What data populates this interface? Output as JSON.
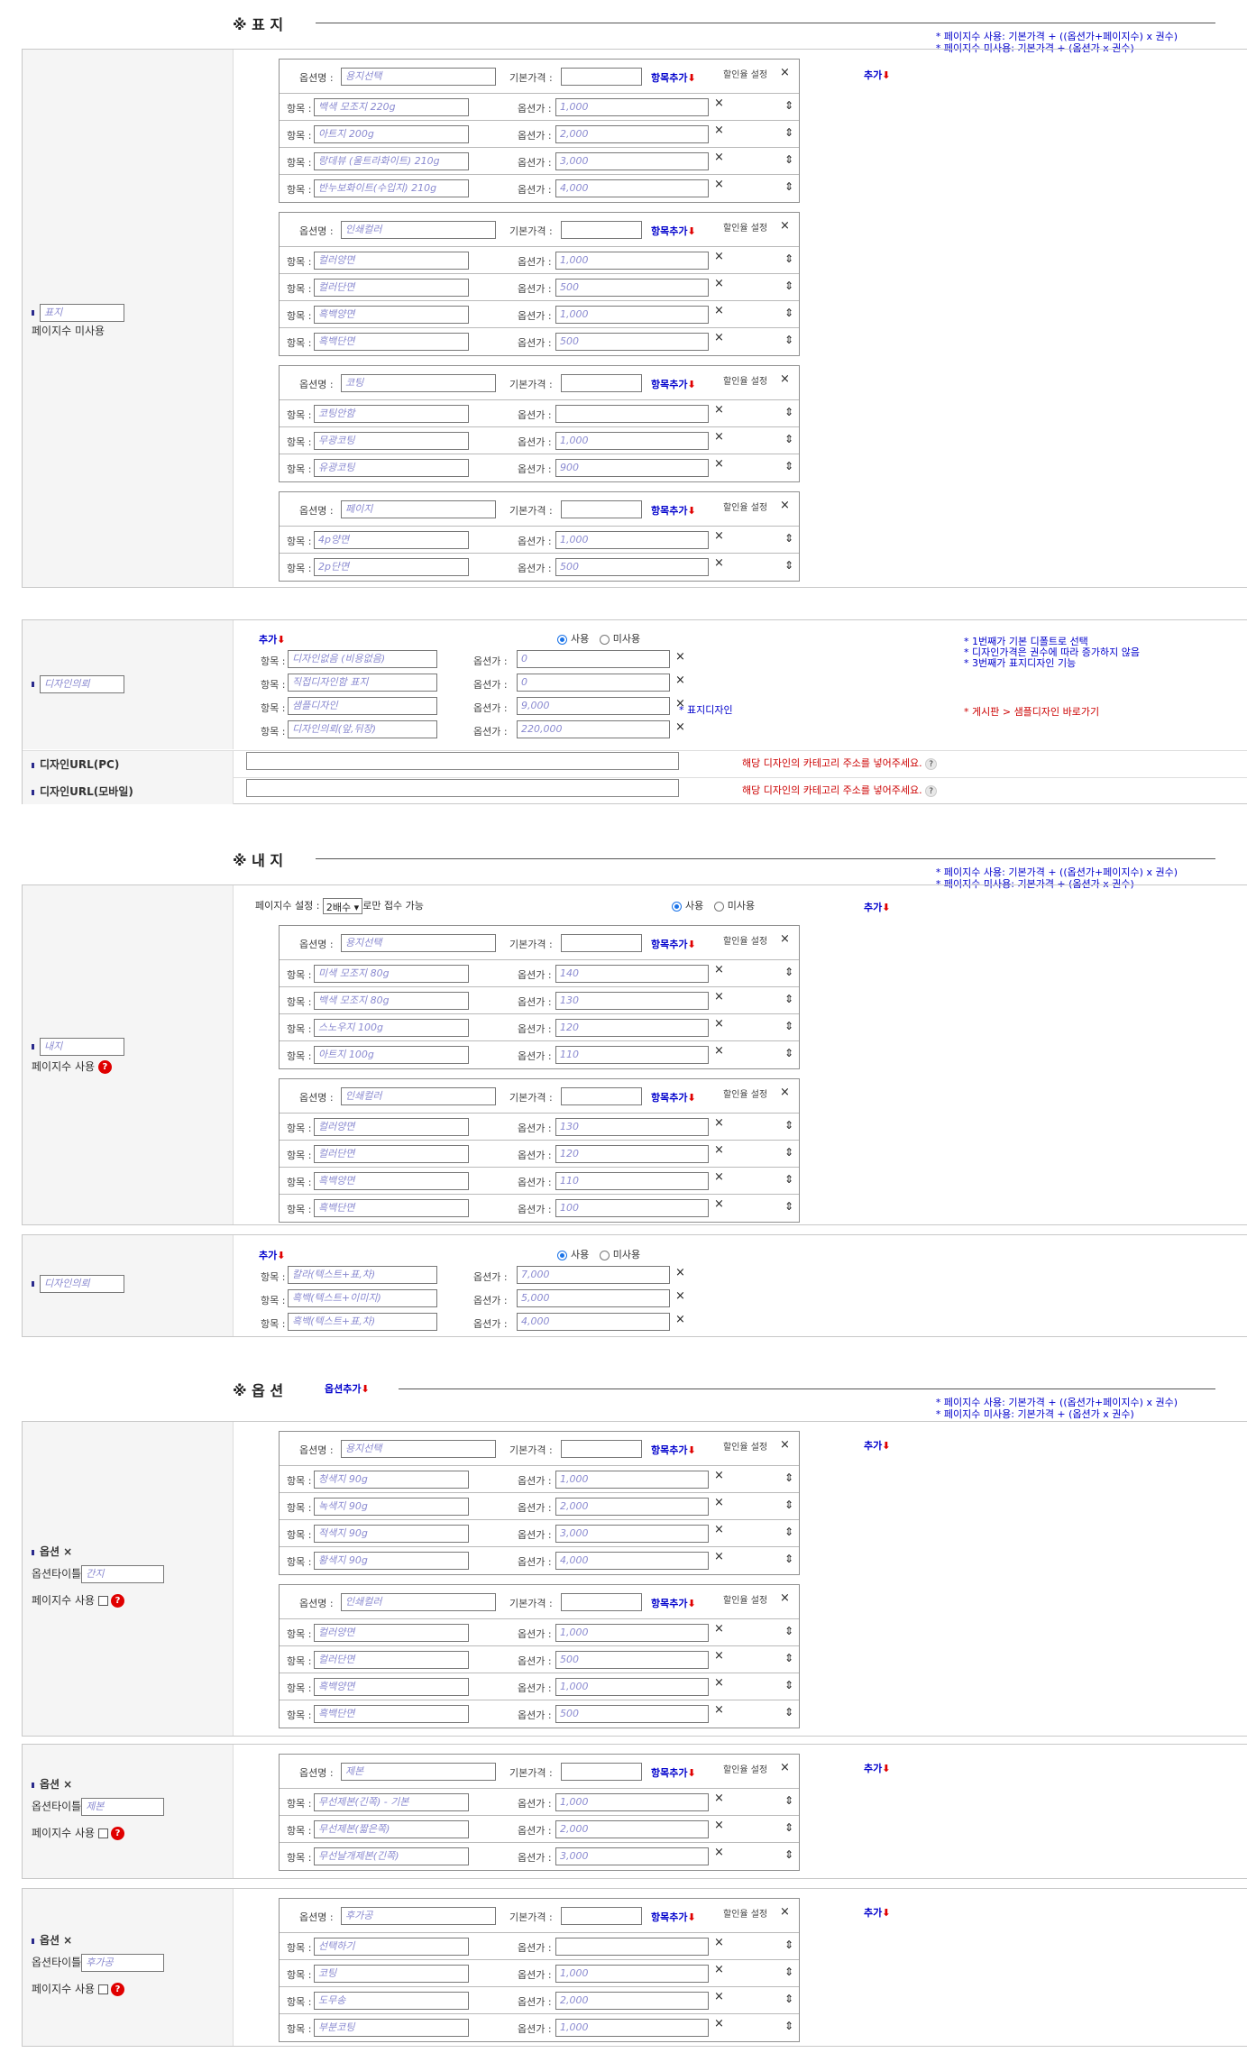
{
  "labels": {
    "option_name": "옵션명 :",
    "base_price": "기본가격 :",
    "item": "항목 :",
    "option_price": "옵션가 :",
    "add_item": "항목추가",
    "discount": "할인율 설정",
    "add": "추가",
    "use": "사용",
    "unuse": "미사용",
    "add_option": "옵션추가"
  },
  "formula_note": [
    "* 페이지수 사용: 기본가격 + ((옵션가+페이지수) x 권수)",
    "* 페이지수 미사용: 기본가격 + (옵션가 x 권수)"
  ],
  "cover": {
    "title": "※ 표 지",
    "label_value": "표지",
    "page_text": "페이지수 미사용",
    "groups": [
      {
        "name": "용지선택",
        "items": [
          {
            "name": "백색 모조지 220g",
            "price": "1,000"
          },
          {
            "name": "아트지 200g",
            "price": "2,000"
          },
          {
            "name": "랑데뷰 (울트라화이트) 210g",
            "price": "3,000"
          },
          {
            "name": "반누보화이트(수입지) 210g",
            "price": "4,000"
          }
        ]
      },
      {
        "name": "인쇄컬러",
        "items": [
          {
            "name": "컬러양면",
            "price": "1,000"
          },
          {
            "name": "컬러단면",
            "price": "500"
          },
          {
            "name": "흑백양면",
            "price": "1,000"
          },
          {
            "name": "흑백단면",
            "price": "500"
          }
        ]
      },
      {
        "name": "코팅",
        "items": [
          {
            "name": "코팅안함",
            "price": ""
          },
          {
            "name": "무광코팅",
            "price": "1,000"
          },
          {
            "name": "유광코팅",
            "price": "900"
          }
        ]
      },
      {
        "name": "페이지",
        "items": [
          {
            "name": "4p양면",
            "price": "1,000"
          },
          {
            "name": "2p단면",
            "price": "500"
          }
        ]
      }
    ]
  },
  "design1": {
    "label_value": "디자인의뢰",
    "items": [
      {
        "name": "디자인없음 (비용없음)",
        "price": "0"
      },
      {
        "name": "직접디자인함 표지",
        "price": "0"
      },
      {
        "name": "샘플디자인",
        "price": "9,000"
      },
      {
        "name": "디자인의뢰(앞,뒤장)",
        "price": "220,000"
      }
    ],
    "cover_design": "* 표지디자인",
    "notes": [
      "* 1번째가 기본 디폴트로 선택",
      "* 디자인가격은 권수에 따라 증가하지 않음",
      "* 3번째가 표지디자인 기능"
    ],
    "board_link": "* 게시판 > 샘플디자인 바로가기",
    "url_pc_label": "디자인URL(PC)",
    "url_mobile_label": "디자인URL(모바일)",
    "url_note": "해당 디자인의 카테고리 주소를 넣어주세요."
  },
  "inner": {
    "title": "※ 내 지",
    "label_value": "내지",
    "page_text": "페이지수 사용",
    "page_setting_label": "페이지수 설정 :",
    "page_setting_value": "2배수",
    "page_setting_suffix": "로만 접수 가능",
    "groups": [
      {
        "name": "용지선택",
        "items": [
          {
            "name": "미색 모조지 80g",
            "price": "140"
          },
          {
            "name": "백색 모조지 80g",
            "price": "130"
          },
          {
            "name": "스노우지 100g",
            "price": "120"
          },
          {
            "name": "아트지 100g",
            "price": "110"
          }
        ]
      },
      {
        "name": "인쇄컬러",
        "items": [
          {
            "name": "컬러양면",
            "price": "130"
          },
          {
            "name": "컬러단면",
            "price": "120"
          },
          {
            "name": "흑백양면",
            "price": "110"
          },
          {
            "name": "흑백단면",
            "price": "100"
          }
        ]
      }
    ]
  },
  "design2": {
    "label_value": "디자인의뢰",
    "items": [
      {
        "name": "칼라(텍스트+표,차)",
        "price": "7,000"
      },
      {
        "name": "흑백(텍스트+이미지)",
        "price": "5,000"
      },
      {
        "name": "흑백(텍스트+표,차)",
        "price": "4,000"
      }
    ]
  },
  "options": {
    "title": "※ 옵 션",
    "label": "옵션",
    "title_label": "옵션타이틀",
    "page_label": "페이지수 사용",
    "blocks": [
      {
        "title_value": "간지",
        "groups": [
          {
            "name": "용지선택",
            "items": [
              {
                "name": "청색지 90g",
                "price": "1,000"
              },
              {
                "name": "녹색지 90g",
                "price": "2,000"
              },
              {
                "name": "적색지 90g",
                "price": "3,000"
              },
              {
                "name": "황색지 90g",
                "price": "4,000"
              }
            ]
          },
          {
            "name": "인쇄컬러",
            "items": [
              {
                "name": "컬러양면",
                "price": "1,000"
              },
              {
                "name": "컬러단면",
                "price": "500"
              },
              {
                "name": "흑백양면",
                "price": "1,000"
              },
              {
                "name": "흑백단면",
                "price": "500"
              }
            ]
          }
        ]
      },
      {
        "title_value": "제본",
        "groups": [
          {
            "name": "제본",
            "items": [
              {
                "name": "무선제본(긴쪽) - 기본",
                "price": "1,000"
              },
              {
                "name": "무선제본(짧은쪽)",
                "price": "2,000"
              },
              {
                "name": "무선날개제본(긴쪽)",
                "price": "3,000"
              }
            ]
          }
        ]
      },
      {
        "title_value": "후가공",
        "groups": [
          {
            "name": "후가공",
            "items": [
              {
                "name": "선택하기",
                "price": ""
              },
              {
                "name": "코팅",
                "price": "1,000"
              },
              {
                "name": "도무송",
                "price": "2,000"
              },
              {
                "name": "부분코팅",
                "price": "1,000"
              }
            ]
          }
        ]
      }
    ]
  }
}
